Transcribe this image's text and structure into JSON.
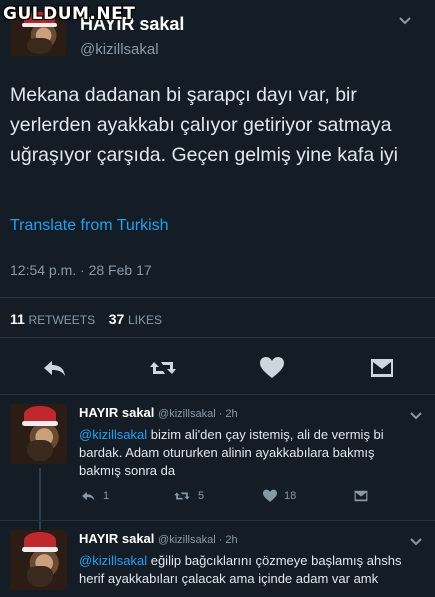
{
  "watermark": "GULDUM.NET",
  "tweet": {
    "display_name": "HAYIR sakal",
    "handle": "@kizillsakal",
    "text": "Mekana dadanan bi şarapçı dayı var, bir yerlerden ayakkabı çalıyor getiriyor  satmaya uğraşıyor çarşıda. Geçen gelmiş yine kafa iyi",
    "translate_label": "Translate from Turkish",
    "timestamp": "12:54 p.m. · 28 Feb 17",
    "retweets_count": "11",
    "retweets_label": "RETWEETS",
    "likes_count": "37",
    "likes_label": "LIKES"
  },
  "icons": {
    "reply": "reply-icon",
    "retweet": "retweet-icon",
    "like": "heart-icon",
    "dm": "envelope-icon",
    "menu": "chevron-down-icon"
  },
  "colors": {
    "background": "#141d26",
    "link": "#1da1f2",
    "muted": "#8899a6"
  },
  "replies": [
    {
      "display_name": "HAYIR sakal",
      "meta": "@kizillsakal · 2h",
      "mention": "@kizillsakal",
      "text": " bizim ali'den çay istemiş, ali de vermiş bi bardak. Adam otururken alinin ayakkabılara bakmış bakmış sonra da",
      "reply_count": "1",
      "retweet_count": "5",
      "like_count": "18"
    },
    {
      "display_name": "HAYIR sakal",
      "meta": "@kizillsakal · 2h",
      "mention": "@kizillsakal",
      "text": " eğilip bağcıklarını çözmeye başlamış ahshs herif ayakkabıları çalacak ama içinde adam var amk"
    }
  ]
}
